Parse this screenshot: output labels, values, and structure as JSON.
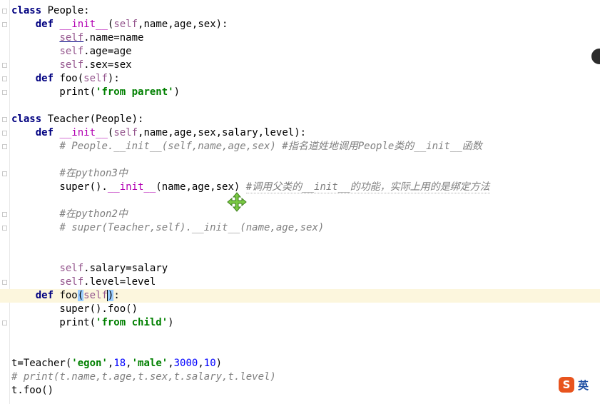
{
  "editor": {
    "lines": [
      {
        "segs": [
          {
            "t": "class",
            "c": "kw"
          },
          {
            "t": " People:"
          }
        ]
      },
      {
        "segs": [
          {
            "t": "    "
          },
          {
            "t": "def",
            "c": "kw"
          },
          {
            "t": " "
          },
          {
            "t": "__init__",
            "c": "magic"
          },
          {
            "t": "("
          },
          {
            "t": "self",
            "c": "self"
          },
          {
            "t": ",name,age,sex):"
          }
        ]
      },
      {
        "segs": [
          {
            "t": "        "
          },
          {
            "t": "self",
            "c": "self hl-under"
          },
          {
            "t": ".name=name"
          }
        ]
      },
      {
        "segs": [
          {
            "t": "        "
          },
          {
            "t": "self",
            "c": "self"
          },
          {
            "t": ".age=age"
          }
        ]
      },
      {
        "segs": [
          {
            "t": "        "
          },
          {
            "t": "self",
            "c": "self"
          },
          {
            "t": ".sex=sex"
          }
        ]
      },
      {
        "segs": [
          {
            "t": "    "
          },
          {
            "t": "def",
            "c": "kw"
          },
          {
            "t": " foo("
          },
          {
            "t": "self",
            "c": "self"
          },
          {
            "t": "):"
          }
        ]
      },
      {
        "segs": [
          {
            "t": "        print("
          },
          {
            "t": "'from parent'",
            "c": "str"
          },
          {
            "t": ")"
          }
        ]
      },
      {
        "segs": []
      },
      {
        "segs": [
          {
            "t": "class",
            "c": "kw"
          },
          {
            "t": " Teacher(People):"
          }
        ]
      },
      {
        "segs": [
          {
            "t": "    "
          },
          {
            "t": "def",
            "c": "kw"
          },
          {
            "t": " "
          },
          {
            "t": "__init__",
            "c": "magic"
          },
          {
            "t": "("
          },
          {
            "t": "self",
            "c": "self"
          },
          {
            "t": ",name,age,sex,salary,level):"
          }
        ]
      },
      {
        "segs": [
          {
            "t": "        "
          },
          {
            "t": "# People.__init__(self,name,age,sex) #指名道姓地调用People类的__init__函数",
            "c": "cmt"
          }
        ]
      },
      {
        "segs": []
      },
      {
        "segs": [
          {
            "t": "        "
          },
          {
            "t": "#在python3中",
            "c": "cmt"
          }
        ]
      },
      {
        "segs": [
          {
            "t": "        super()."
          },
          {
            "t": "__init__",
            "c": "magic"
          },
          {
            "t": "(name,age,sex) "
          },
          {
            "t": "#调用父类的__init__的功能，实际上用的是绑定方法",
            "c": "cmt box-under"
          }
        ]
      },
      {
        "segs": []
      },
      {
        "segs": [
          {
            "t": "        "
          },
          {
            "t": "#在python2中",
            "c": "cmt"
          }
        ]
      },
      {
        "segs": [
          {
            "t": "        "
          },
          {
            "t": "# super(Teacher,self).__init__(name,age,sex)",
            "c": "cmt"
          }
        ]
      },
      {
        "segs": []
      },
      {
        "segs": []
      },
      {
        "segs": [
          {
            "t": "        "
          },
          {
            "t": "self",
            "c": "self"
          },
          {
            "t": ".salary=salary"
          }
        ]
      },
      {
        "segs": [
          {
            "t": "        "
          },
          {
            "t": "self",
            "c": "self"
          },
          {
            "t": ".level=level"
          }
        ]
      },
      {
        "current": true,
        "segs": [
          {
            "t": "    "
          },
          {
            "t": "def",
            "c": "kw"
          },
          {
            "t": " foo"
          },
          {
            "t": "(",
            "c": "sel-paren"
          },
          {
            "t": "self",
            "c": "self"
          },
          {
            "t": ")",
            "c": "sel-paren caret"
          },
          {
            "t": ":"
          }
        ]
      },
      {
        "segs": [
          {
            "t": "        super().foo()"
          }
        ]
      },
      {
        "segs": [
          {
            "t": "        print("
          },
          {
            "t": "'from child'",
            "c": "str"
          },
          {
            "t": ")"
          }
        ]
      },
      {
        "segs": []
      },
      {
        "segs": []
      },
      {
        "segs": [
          {
            "t": "t=Teacher("
          },
          {
            "t": "'egon'",
            "c": "str"
          },
          {
            "t": ","
          },
          {
            "t": "18",
            "c": "num"
          },
          {
            "t": ","
          },
          {
            "t": "'male'",
            "c": "str"
          },
          {
            "t": ","
          },
          {
            "t": "3000",
            "c": "num"
          },
          {
            "t": ","
          },
          {
            "t": "10",
            "c": "num"
          },
          {
            "t": ")"
          }
        ]
      },
      {
        "segs": [
          {
            "t": "# print(t.name,t.age,t.sex,t.salary,t.level)",
            "c": "cmt"
          }
        ]
      },
      {
        "segs": [
          {
            "t": "t.foo()"
          }
        ]
      }
    ]
  },
  "ime": {
    "logo": "S",
    "mode": "英"
  },
  "colors": {
    "keyword": "#000080",
    "self": "#94558d",
    "magic": "#b200b2",
    "string": "#008000",
    "number": "#0000ff",
    "comment": "#808080"
  }
}
